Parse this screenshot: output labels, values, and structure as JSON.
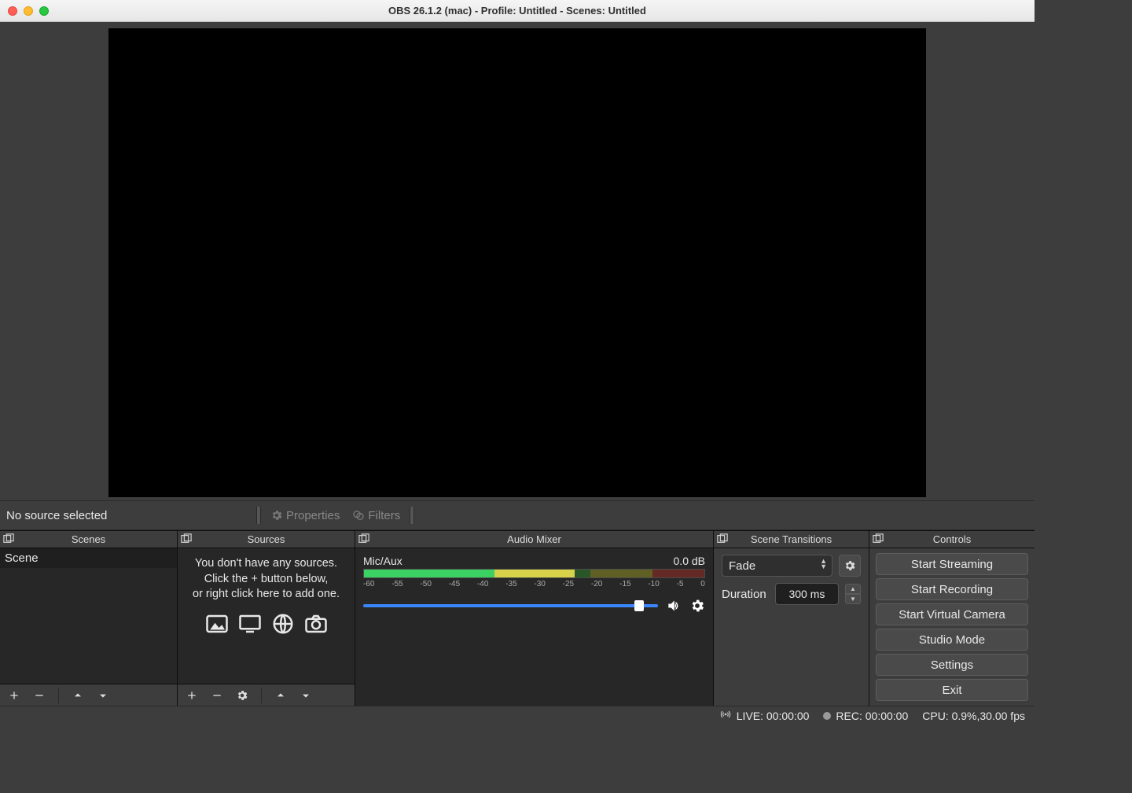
{
  "window": {
    "title": "OBS 26.1.2 (mac) - Profile: Untitled - Scenes: Untitled"
  },
  "src_toolbar": {
    "status": "No source selected",
    "properties": "Properties",
    "filters": "Filters"
  },
  "panels": {
    "scenes": {
      "title": "Scenes",
      "items": [
        "Scene"
      ]
    },
    "sources": {
      "title": "Sources",
      "empty_line1": "You don't have any sources.",
      "empty_line2": "Click the + button below,",
      "empty_line3": "or right click here to add one."
    },
    "mixer": {
      "title": "Audio Mixer",
      "channel_name": "Mic/Aux",
      "channel_db": "0.0 dB",
      "ticks": [
        "-60",
        "-55",
        "-50",
        "-45",
        "-40",
        "-35",
        "-30",
        "-25",
        "-20",
        "-15",
        "-10",
        "-5",
        "0"
      ]
    },
    "transitions": {
      "title": "Scene Transitions",
      "select_value": "Fade",
      "duration_label": "Duration",
      "duration_value": "300 ms"
    },
    "controls": {
      "title": "Controls",
      "buttons": [
        "Start Streaming",
        "Start Recording",
        "Start Virtual Camera",
        "Studio Mode",
        "Settings",
        "Exit"
      ]
    }
  },
  "statusbar": {
    "live": "LIVE: 00:00:00",
    "rec": "REC: 00:00:00",
    "cpu": "CPU: 0.9%,30.00 fps"
  }
}
